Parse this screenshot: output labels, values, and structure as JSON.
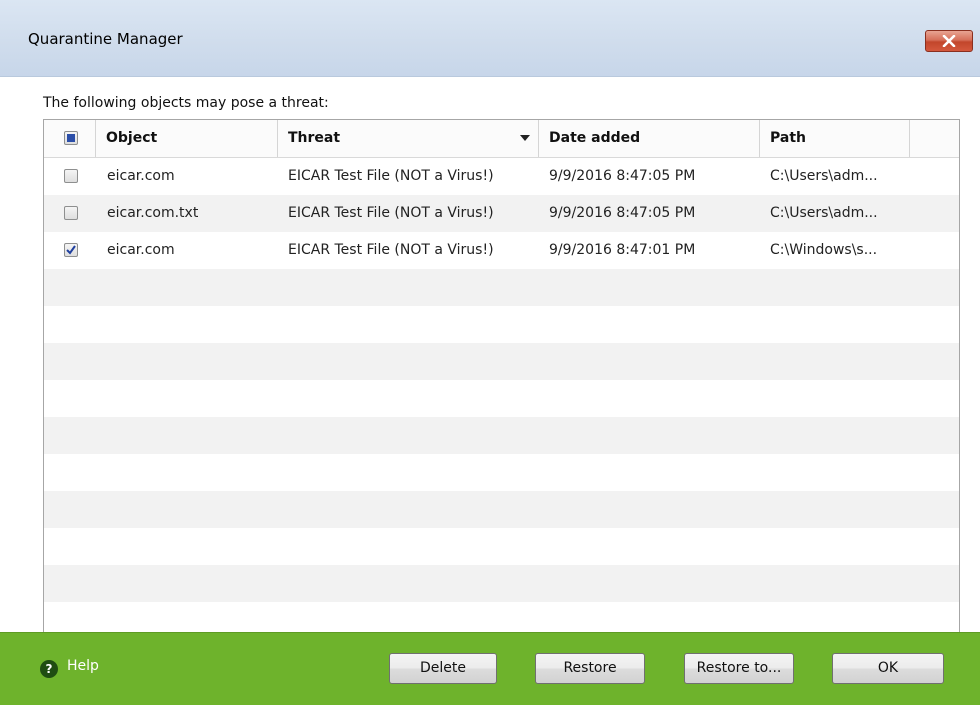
{
  "window": {
    "title": "Quarantine Manager"
  },
  "intro_text": "The following objects may pose a threat:",
  "table": {
    "columns": [
      "Object",
      "Threat",
      "Date added",
      "Path"
    ],
    "sorted_column": "Threat",
    "header_checkbox_state": "indeterminate",
    "rows": [
      {
        "checked": false,
        "object": "eicar.com",
        "threat": "EICAR Test File (NOT a Virus!)",
        "date": "9/9/2016 8:47:05 PM",
        "path": "C:\\Users\\adm..."
      },
      {
        "checked": false,
        "object": "eicar.com.txt",
        "threat": "EICAR Test File (NOT a Virus!)",
        "date": "9/9/2016 8:47:05 PM",
        "path": "C:\\Users\\adm..."
      },
      {
        "checked": true,
        "object": "eicar.com",
        "threat": "EICAR Test File (NOT a Virus!)",
        "date": "9/9/2016 8:47:01 PM",
        "path": "C:\\Windows\\s..."
      }
    ]
  },
  "footer": {
    "help_label": "Help",
    "help_icon": "question-circle-icon",
    "buttons": {
      "delete": "Delete",
      "restore": "Restore",
      "restore_to": "Restore to...",
      "ok": "OK"
    }
  },
  "colors": {
    "footer_green": "#6eb32c",
    "close_button_red": "#c2462b",
    "titlebar_blue": "#cfdcec"
  }
}
